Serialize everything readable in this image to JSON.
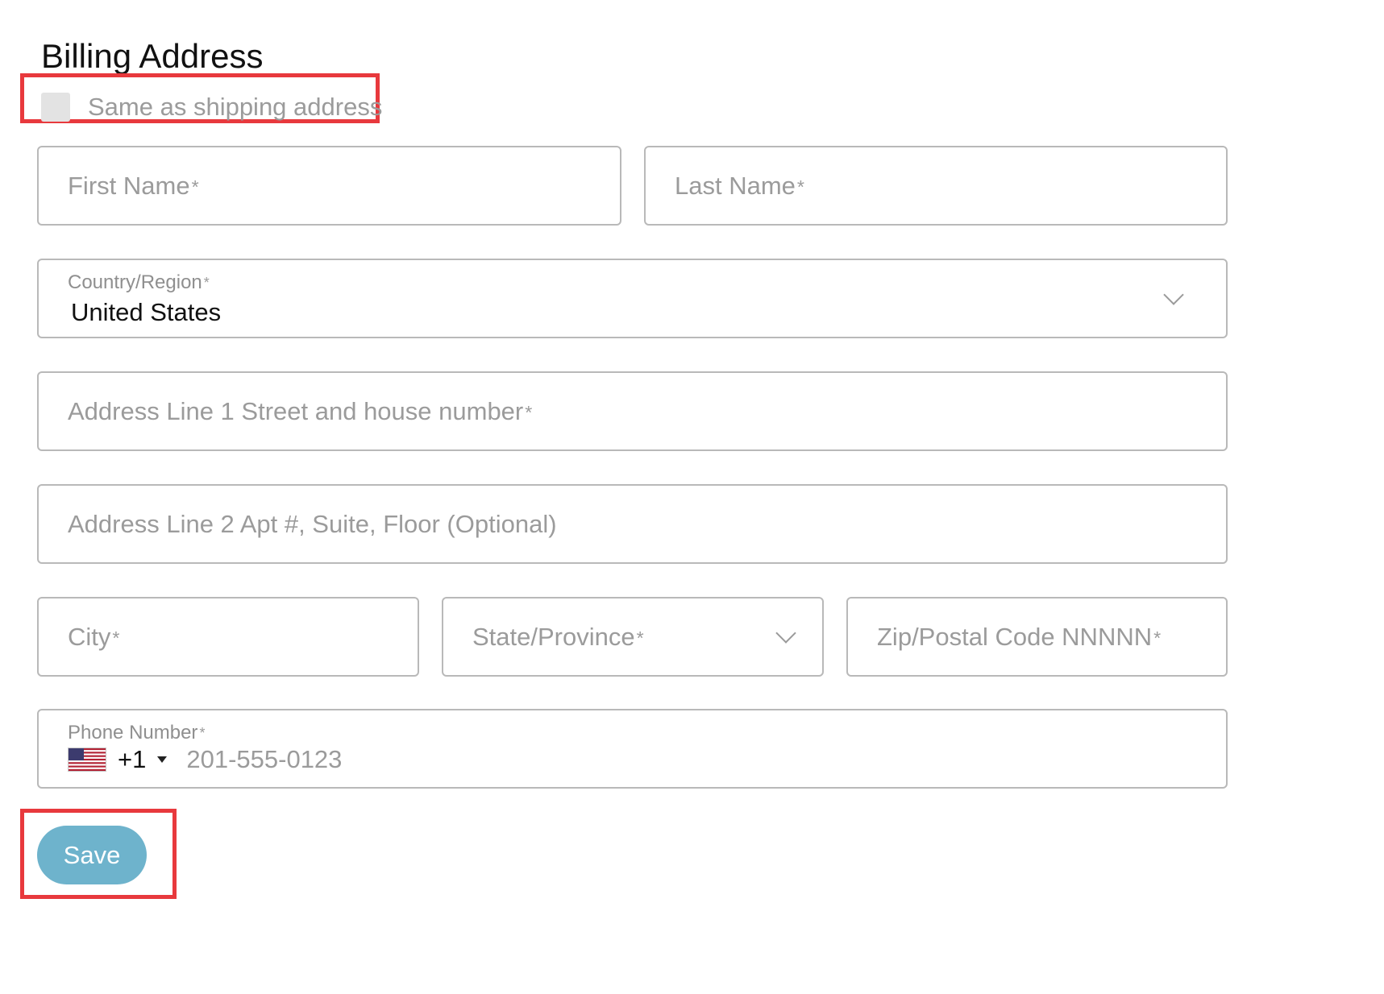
{
  "form": {
    "title": "Billing Address",
    "same_as_shipping": {
      "label": "Same as shipping address",
      "checked": false
    },
    "first_name": {
      "placeholder": "First Name",
      "required_mark": "*"
    },
    "last_name": {
      "placeholder": "Last Name",
      "required_mark": "*"
    },
    "country": {
      "label": "Country/Region",
      "required_mark": "*",
      "value": "United States"
    },
    "address1": {
      "placeholder": "Address Line 1 Street and house number",
      "required_mark": "*"
    },
    "address2": {
      "placeholder": "Address Line 2 Apt #, Suite, Floor (Optional)"
    },
    "city": {
      "placeholder": "City",
      "required_mark": "*"
    },
    "state": {
      "placeholder": "State/Province",
      "required_mark": "*"
    },
    "zip": {
      "placeholder": "Zip/Postal Code NNNNN",
      "required_mark": "*"
    },
    "phone": {
      "label": "Phone Number",
      "required_mark": "*",
      "flag_icon": "us-flag-icon",
      "dial_code": "+1",
      "placeholder": "201-555-0123"
    },
    "save_label": "Save"
  },
  "colors": {
    "save_button": "#6eb3cc",
    "highlight_box": "#e8393d",
    "field_border": "#b9b9b9",
    "placeholder_text": "#9b9b9b"
  }
}
